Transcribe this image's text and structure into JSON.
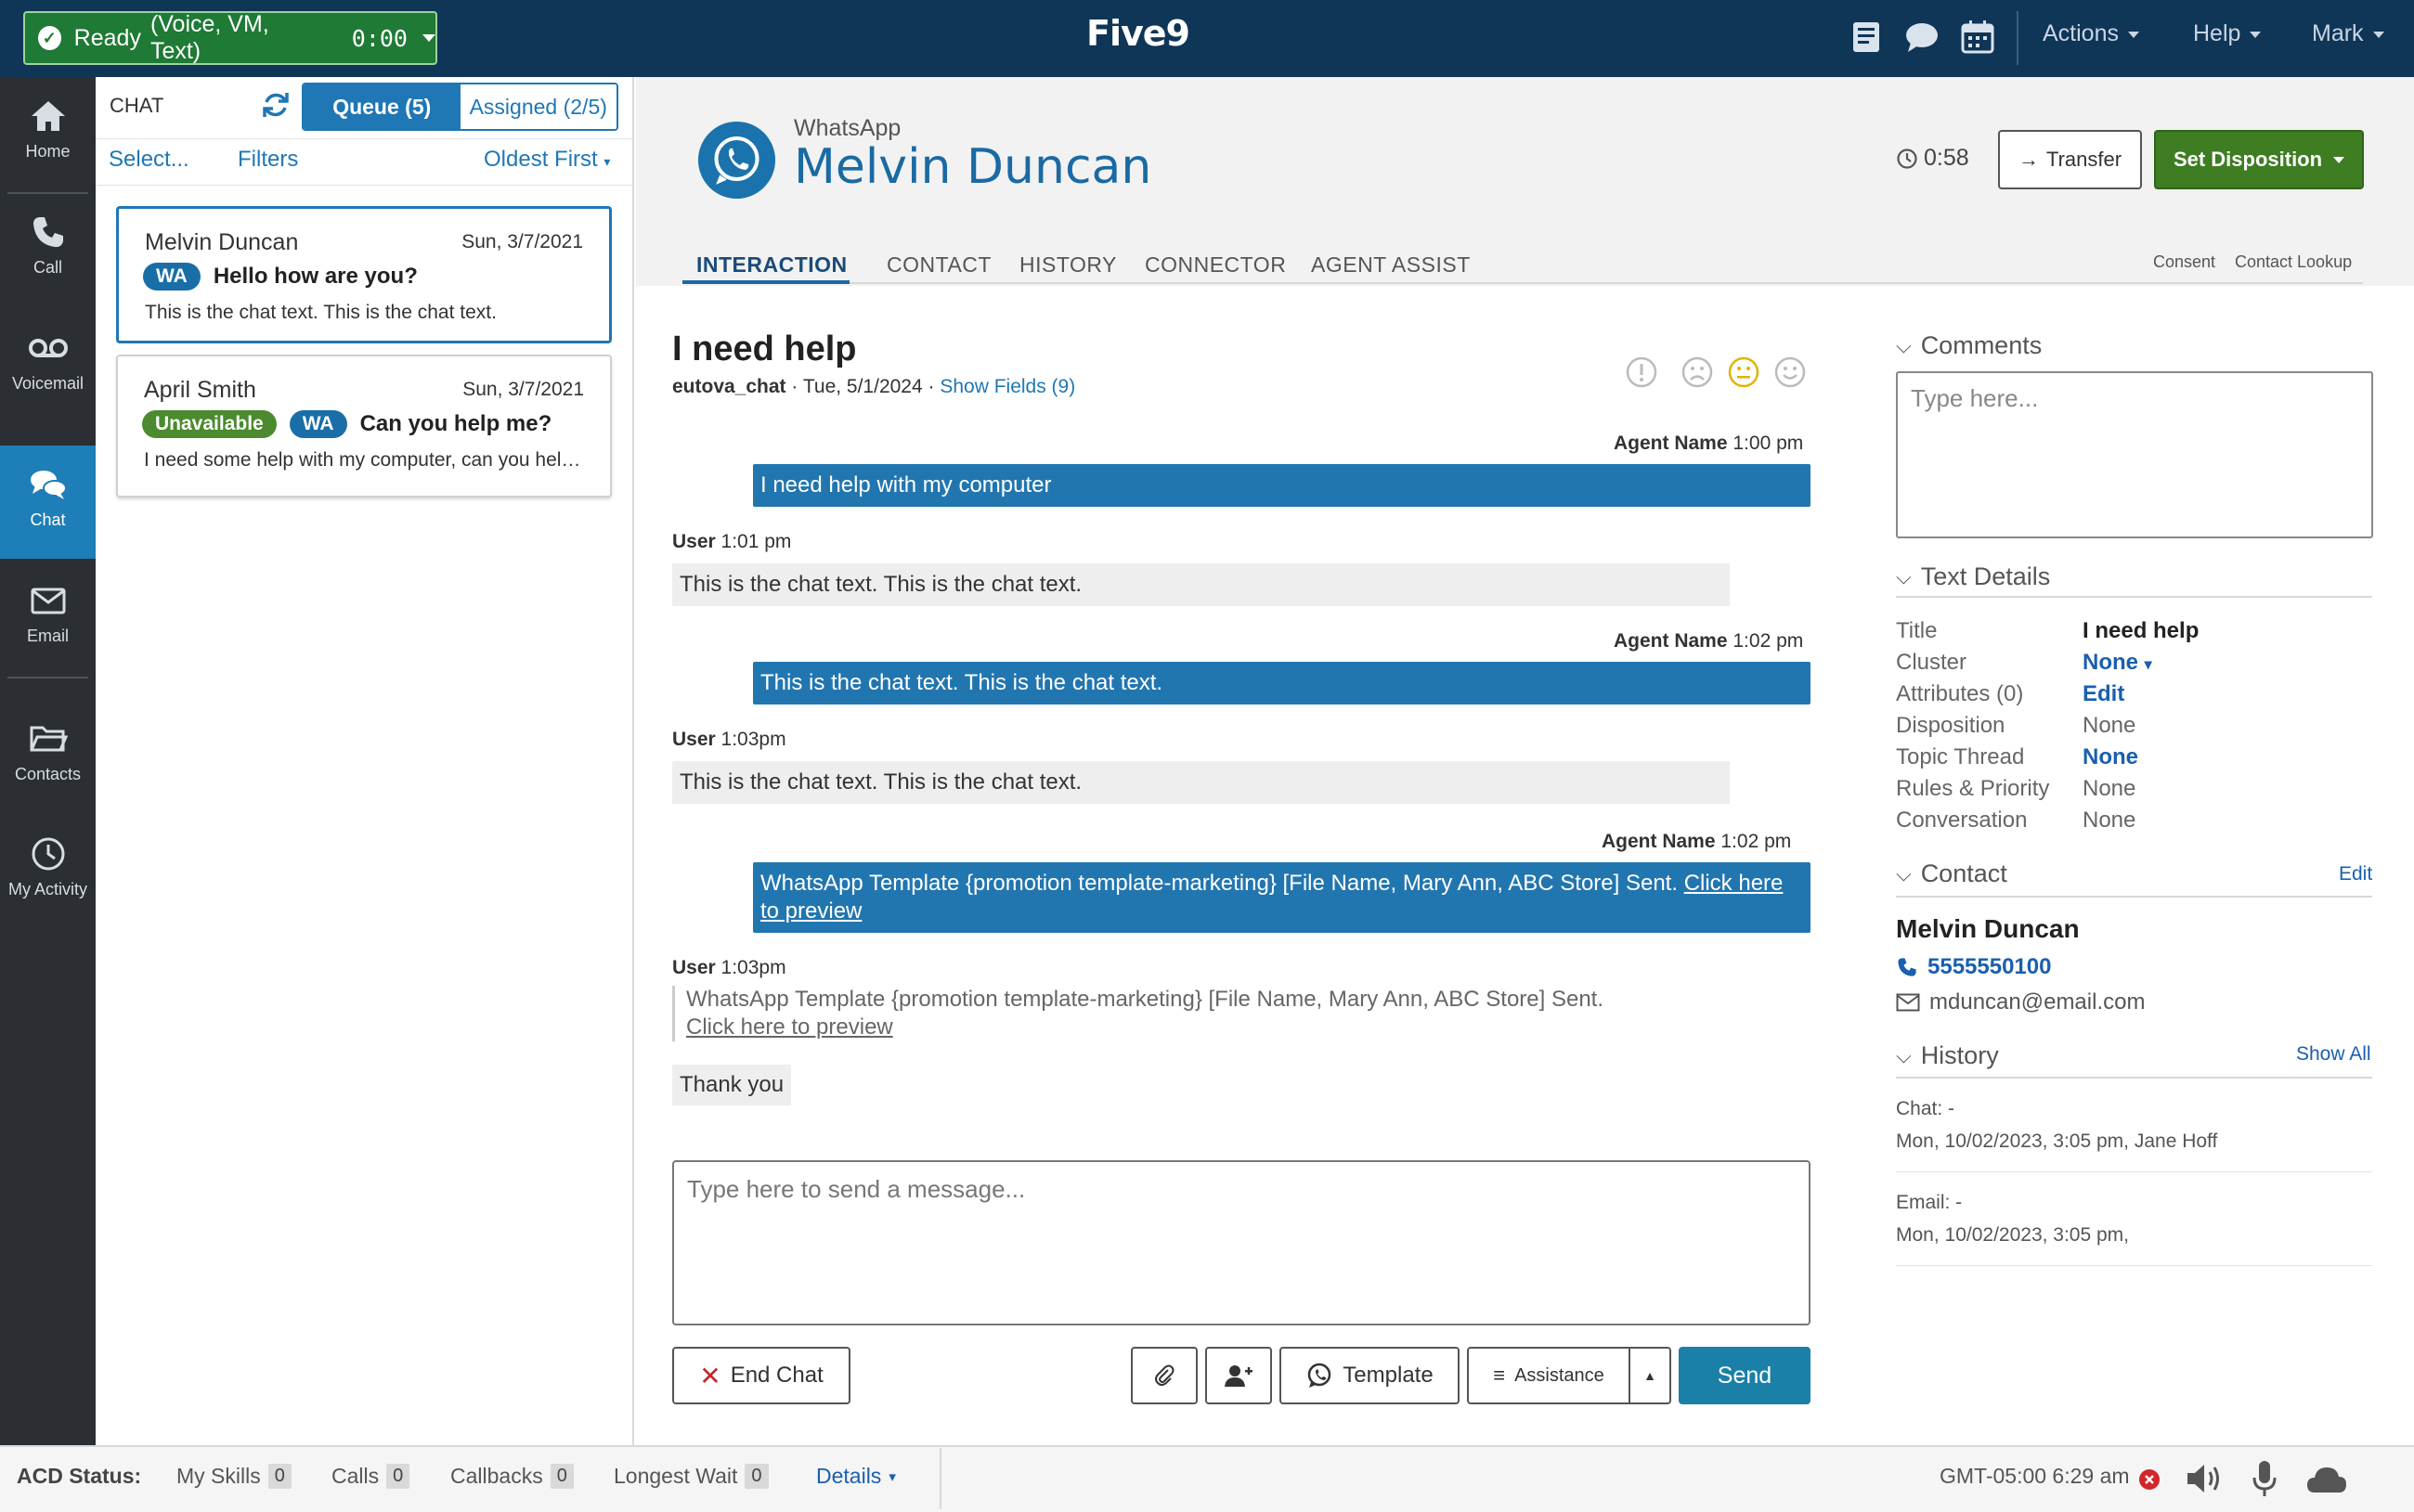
{
  "topbar": {
    "status_label": "Ready",
    "status_channels": "(Voice, VM, Text)",
    "status_timer": "0:00",
    "logo": "Five9",
    "icons": [
      "book-icon",
      "chat-bubble-icon",
      "calendar-icon"
    ],
    "menus": {
      "actions": "Actions",
      "help": "Help",
      "user": "Mark"
    },
    "colors": {
      "bar": "#0f3557",
      "ready": "#1e7a35"
    }
  },
  "nav": {
    "items": [
      {
        "label": "Home",
        "icon": "home-icon"
      },
      {
        "label": "Call",
        "icon": "phone-icon"
      },
      {
        "label": "Voicemail",
        "icon": "voicemail-icon"
      },
      {
        "label": "Chat",
        "icon": "chat-icon"
      },
      {
        "label": "Email",
        "icon": "envelope-icon"
      },
      {
        "label": "Contacts",
        "icon": "folder-icon"
      },
      {
        "label": "My Activity",
        "icon": "clock-icon"
      }
    ],
    "active": "Chat"
  },
  "chatlist": {
    "title": "CHAT",
    "tab_queue": "Queue (5)",
    "tab_assigned": "Assigned (2/5)",
    "select": "Select...",
    "filters": "Filters",
    "sort": "Oldest First",
    "items": [
      {
        "name": "Melvin Duncan",
        "date": "Sun, 3/7/2021",
        "badge": "WA",
        "message": "Hello how are you?",
        "preview": "This is the chat text. This is the chat text."
      },
      {
        "name": "April Smith",
        "date": "Sun, 3/7/2021",
        "status": "Unavailable",
        "badge": "WA",
        "message": "Can you help me?",
        "preview": "I need some help with my computer, can you help me with this problem"
      }
    ]
  },
  "header": {
    "channel": "WhatsApp",
    "contact_name": "Melvin Duncan",
    "timer": "0:58",
    "transfer": "Transfer",
    "set_disposition": "Set Disposition"
  },
  "tabs": {
    "interaction": "INTERACTION",
    "contact": "CONTACT",
    "history": "HISTORY",
    "connector": "CONNECTOR",
    "agent_assist": "AGENT ASSIST",
    "consent": "Consent",
    "contact_lookup": "Contact Lookup"
  },
  "conversation": {
    "title": "I need help",
    "source": "eutova_chat",
    "date": "Tue, 5/1/2024",
    "show_fields": "Show Fields (9)",
    "sentiments": [
      "alert-icon",
      "sad-icon",
      "neutral-icon",
      "happy-icon"
    ],
    "messages": [
      {
        "from": "Agent Name",
        "time": "1:00 pm",
        "text": "I need help with my computer"
      },
      {
        "from": "User",
        "time": "1:01 pm",
        "text": "This is the chat text. This is the chat text."
      },
      {
        "from": "Agent Name",
        "time": "1:02 pm",
        "text": "This is the chat text. This is the chat text."
      },
      {
        "from": "User",
        "time": "1:03pm",
        "text": "This is the chat text. This is the chat text."
      },
      {
        "from": "Agent Name",
        "time": "1:02 pm",
        "text": "WhatsApp Template {promotion template-marketing} [File Name, Mary Ann, ABC Store] Sent. ",
        "link": "Click here to preview"
      },
      {
        "from": "User",
        "time": "1:03pm",
        "quote": "WhatsApp Template {promotion template-marketing} [File Name, Mary Ann, ABC Store] Sent. ",
        "link": "Click here to preview",
        "text": "Thank you"
      }
    ],
    "composer_placeholder": "Type here to send a message...",
    "end_chat": "End Chat",
    "template": "Template",
    "assistance": "Assistance",
    "send": "Send"
  },
  "right": {
    "comments_title": "Comments",
    "comments_placeholder": "Type here...",
    "details_title": "Text Details",
    "details": [
      {
        "label": "Title",
        "value": "I need help"
      },
      {
        "label": "Cluster",
        "value": "None"
      },
      {
        "label": "Attributes (0)",
        "value": "Edit"
      },
      {
        "label": "Disposition",
        "value": "None"
      },
      {
        "label": "Topic Thread",
        "value": "None"
      },
      {
        "label": "Rules & Priority",
        "value": "None"
      },
      {
        "label": "Conversation",
        "value": "None"
      }
    ],
    "contact_title": "Contact",
    "contact_edit": "Edit",
    "contact_name": "Melvin Duncan",
    "contact_phone": "5555550100",
    "contact_email": "mduncan@email.com",
    "history_title": "History",
    "history_show_all": "Show All",
    "history": [
      {
        "type": "Chat: -",
        "detail": "Mon, 10/02/2023, 3:05 pm, Jane Hoff"
      },
      {
        "type": "Email: -",
        "detail": "Mon, 10/02/2023, 3:05 pm,"
      }
    ]
  },
  "bottombar": {
    "acd_status": "ACD Status:",
    "my_skills": "My Skills",
    "my_skills_count": "0",
    "calls": "Calls",
    "calls_count": "0",
    "callbacks": "Callbacks",
    "callbacks_count": "0",
    "longest_wait": "Longest Wait",
    "longest_wait_count": "0",
    "details": "Details",
    "clock": "GMT-05:00 6:29 am"
  }
}
